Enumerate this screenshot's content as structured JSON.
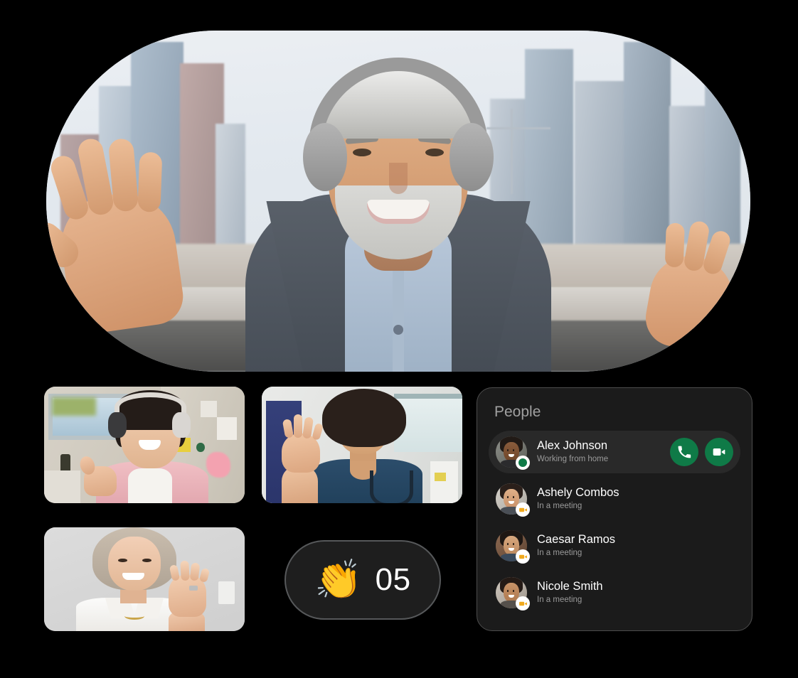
{
  "meeting": {
    "main_speaker": {
      "label": "main-speaker-video",
      "description": "Smiling older man with gray hair wearing over-ear headphones and a gray blazer, waving, city skyline behind him"
    },
    "participant_thumbnails": [
      {
        "id": "thumb-1",
        "description": "Smiling woman with headphones giving a thumbs up in an office"
      },
      {
        "id": "thumb-2",
        "description": "Smiling man with curly hair in navy scrubs with a stethoscope, waving"
      },
      {
        "id": "thumb-3",
        "description": "Smiling older woman in a white blouse waving"
      }
    ],
    "reaction": {
      "emoji": "👏",
      "emoji_name": "clapping-hands",
      "count": "05"
    }
  },
  "people_panel": {
    "title": "People",
    "people": [
      {
        "name": "Alex Johnson",
        "status": "Working from home",
        "presence": "available",
        "active": true,
        "actions": [
          {
            "name": "audio-call-button",
            "icon": "phone-icon"
          },
          {
            "name": "video-call-button",
            "icon": "video-camera-icon"
          }
        ]
      },
      {
        "name": "Ashely Combos",
        "status": "In a meeting",
        "presence": "in-a-meeting",
        "active": false,
        "actions": []
      },
      {
        "name": "Caesar Ramos",
        "status": "In a meeting",
        "presence": "in-a-meeting",
        "active": false,
        "actions": []
      },
      {
        "name": "Nicole Smith",
        "status": "In a meeting",
        "presence": "in-a-meeting",
        "active": false,
        "actions": []
      }
    ]
  },
  "colors": {
    "background": "#000000",
    "panel_bg": "#1b1b1b",
    "panel_row_active": "#292929",
    "panel_border": "#4d4d4d",
    "accent_green": "#0f7a47",
    "presence_available": "#0f7a47",
    "presence_meeting": "#f0a91e",
    "text_primary": "#ffffff",
    "text_secondary": "#9a9a9a",
    "pill_bg": "#1e1e1e",
    "pill_border": "#56585a"
  }
}
